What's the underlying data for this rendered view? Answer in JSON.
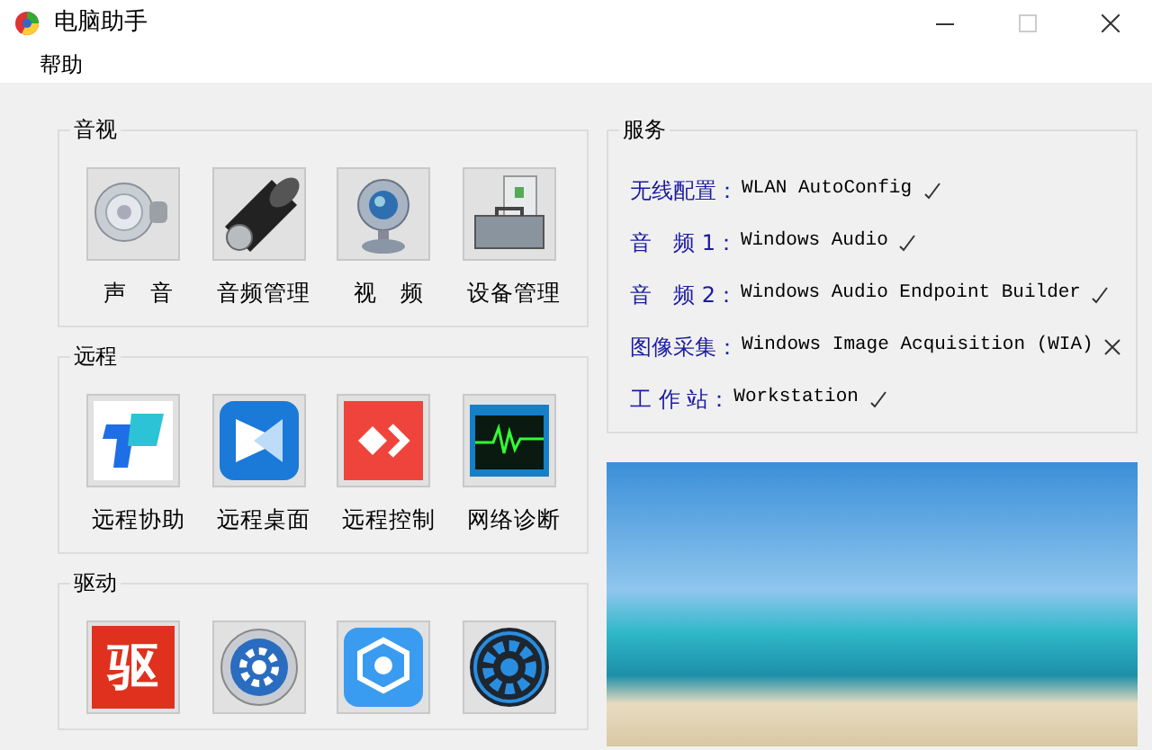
{
  "window": {
    "title": "电脑助手"
  },
  "menu": [
    "帮助"
  ],
  "groups": [
    {
      "title": "音视",
      "items": [
        {
          "kind": "speaker",
          "label": "声　音"
        },
        {
          "kind": "loudspeaker",
          "label": "音频管理"
        },
        {
          "kind": "webcam",
          "label": "视　频"
        },
        {
          "kind": "toolbox",
          "label": "设备管理"
        }
      ]
    },
    {
      "title": "远程",
      "items": [
        {
          "kind": "assist",
          "label": "远程协助"
        },
        {
          "kind": "desktop",
          "label": "远程桌面"
        },
        {
          "kind": "control",
          "label": "远程控制"
        },
        {
          "kind": "monitor",
          "label": "网络诊断"
        }
      ]
    },
    {
      "title": "驱动",
      "items": [
        {
          "kind": "glyph",
          "glyph": "驱"
        },
        {
          "kind": "gear-round"
        },
        {
          "kind": "gear-hex"
        },
        {
          "kind": "gear-dark"
        }
      ]
    }
  ],
  "services": {
    "title": "服务",
    "rows": [
      {
        "label": "无线配置：",
        "service": "WLAN AutoConfig",
        "running": true
      },
      {
        "label": "音　频 1：",
        "service": "Windows Audio",
        "running": true
      },
      {
        "label": "音　频 2：",
        "service": "Windows Audio Endpoint Builder",
        "running": true
      },
      {
        "label": "图像采集：",
        "service": "Windows Image Acquisition (WIA)",
        "running": false
      },
      {
        "label": "工 作 站：",
        "service": "Workstation",
        "running": true
      }
    ]
  }
}
